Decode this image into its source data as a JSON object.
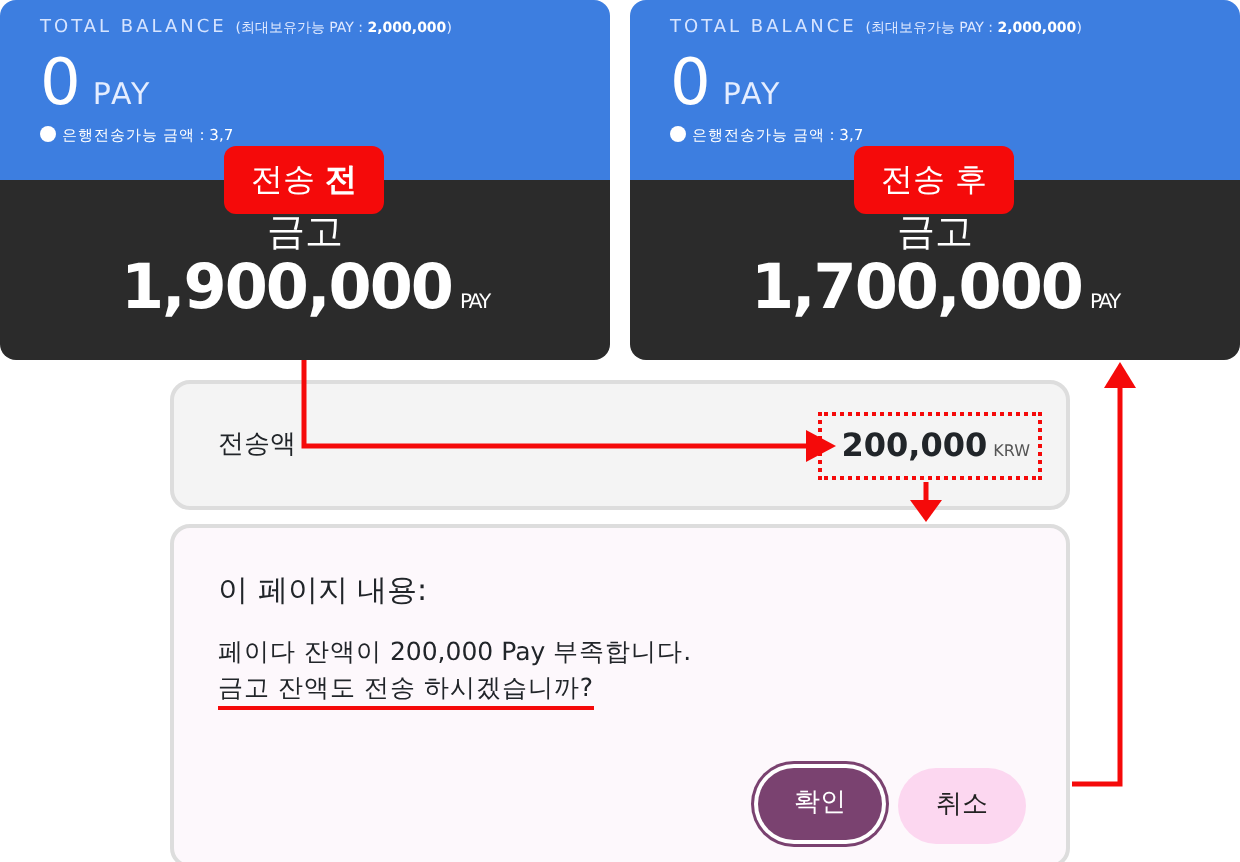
{
  "cards": [
    {
      "label": "TOTAL BALANCE",
      "limit": "(최대보유가능 PAY : **2,000,000**)",
      "balance": "0",
      "unit": "PAY",
      "note": "은행전송가능 금액 : 3,7",
      "badge": "전송 **전**",
      "vault_label": "금고",
      "vault_amount": "1,900,000",
      "vault_unit": "PAY"
    },
    {
      "label": "TOTAL BALANCE",
      "limit": "(최대보유가능 PAY : **2,000,000**)",
      "balance": "0",
      "unit": "PAY",
      "note": "은행전송가능 금액 : 3,7",
      "badge": "전송 후",
      "vault_label": "금고",
      "vault_amount": "1,700,000",
      "vault_unit": "PAY"
    }
  ],
  "transfer": {
    "label": "전송액",
    "amount": "200,000",
    "unit": "KRW"
  },
  "dialog": {
    "title": "이 페이지 내용:",
    "lines": [
      {
        "text": "페이다 잔액이 200,000 Pay 부족합니다.",
        "underlined": false
      },
      {
        "text": "금고 잔액도 전송 하시겠습니까?",
        "underlined": true
      }
    ],
    "buttons": [
      {
        "label": "확인",
        "kind": "primary"
      },
      {
        "label": "취소",
        "kind": "secondary"
      }
    ]
  }
}
